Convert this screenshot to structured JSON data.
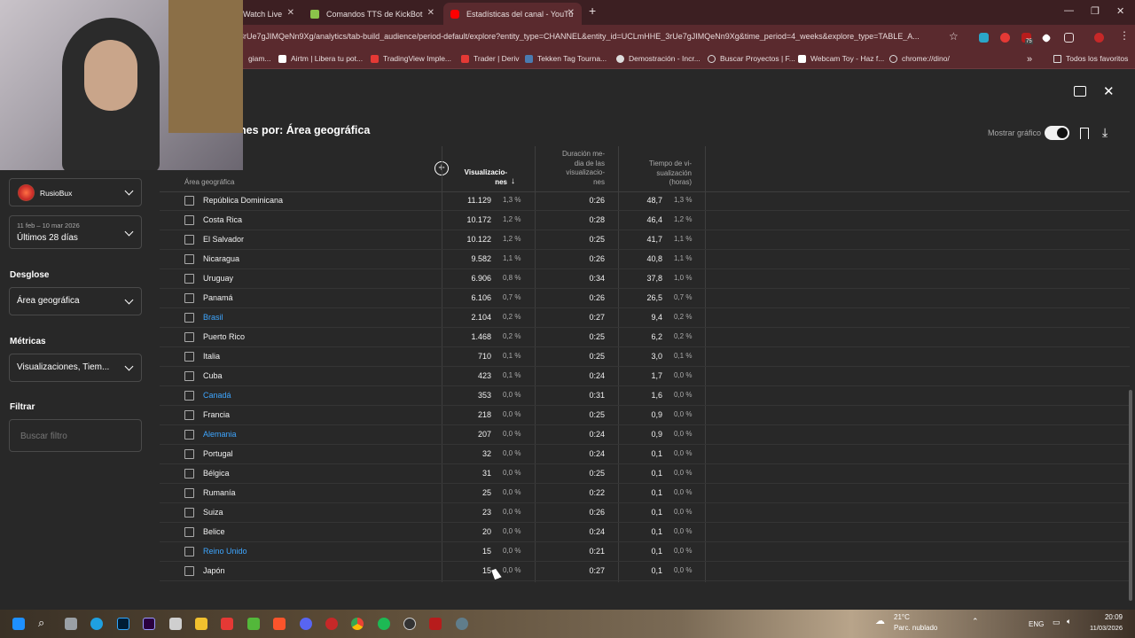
{
  "browser": {
    "tabs": [
      {
        "title": "Watch Live"
      },
      {
        "title": "Comandos TTS de KickBot"
      },
      {
        "title": "Estadísticas del canal - YouTube"
      }
    ],
    "url": "3rUe7gJIMQeNn9Xg/analytics/tab-build_audience/period-default/explore?entity_type=CHANNEL&entity_id=UCLmHHE_3rUe7gJIMQeNn9Xg&time_period=4_weeks&explore_type=TABLE_A...",
    "bookmarks": [
      "giam...",
      "Airtm | Libera tu pot...",
      "TradingView Imple...",
      "Trader | Deriv",
      "Tekken Tag Tourna...",
      "Demostración - Incr...",
      "Buscar Proyectos | F...",
      "Webcam Toy - Haz f...",
      "chrome://dino/"
    ],
    "all_bookmarks": "Todos los favoritos"
  },
  "dialog": {
    "title": "nes por: Área geográfica",
    "show_chart_label": "Mostrar gráfico"
  },
  "sidebar": {
    "channel_name": "RusioBux",
    "date_range_small": "11 feb – 10 mar 2026",
    "date_range": "Últimos 28 días",
    "breakdown_label": "Desglose",
    "breakdown_value": "Área geográfica",
    "metrics_label": "Métricas",
    "metrics_value": "Visualizaciones, Tiem...",
    "filter_label": "Filtrar",
    "filter_placeholder": "Buscar filtro"
  },
  "table": {
    "headers": {
      "geo": "Área geográfica",
      "views": "Visualizacio-\nnes",
      "avg_duration": "Duración me-\ndia de las\nvisualizacio-\nnes",
      "watch_time": "Tiempo de vi-\nsualización\n(horas)"
    },
    "rows": [
      {
        "name": "República Dominicana",
        "link": false,
        "views": "11.129",
        "views_pct": "1,3 %",
        "dur": "0:26",
        "wt": "48,7",
        "wt_pct": "1,3 %"
      },
      {
        "name": "Costa Rica",
        "link": false,
        "views": "10.172",
        "views_pct": "1,2 %",
        "dur": "0:28",
        "wt": "46,4",
        "wt_pct": "1,2 %"
      },
      {
        "name": "El Salvador",
        "link": false,
        "views": "10.122",
        "views_pct": "1,2 %",
        "dur": "0:25",
        "wt": "41,7",
        "wt_pct": "1,1 %"
      },
      {
        "name": "Nicaragua",
        "link": false,
        "views": "9.582",
        "views_pct": "1,1 %",
        "dur": "0:26",
        "wt": "40,8",
        "wt_pct": "1,1 %"
      },
      {
        "name": "Uruguay",
        "link": false,
        "views": "6.906",
        "views_pct": "0,8 %",
        "dur": "0:34",
        "wt": "37,8",
        "wt_pct": "1,0 %"
      },
      {
        "name": "Panamá",
        "link": false,
        "views": "6.106",
        "views_pct": "0,7 %",
        "dur": "0:26",
        "wt": "26,5",
        "wt_pct": "0,7 %"
      },
      {
        "name": "Brasil",
        "link": true,
        "views": "2.104",
        "views_pct": "0,2 %",
        "dur": "0:27",
        "wt": "9,4",
        "wt_pct": "0,2 %"
      },
      {
        "name": "Puerto Rico",
        "link": false,
        "views": "1.468",
        "views_pct": "0,2 %",
        "dur": "0:25",
        "wt": "6,2",
        "wt_pct": "0,2 %"
      },
      {
        "name": "Italia",
        "link": false,
        "views": "710",
        "views_pct": "0,1 %",
        "dur": "0:25",
        "wt": "3,0",
        "wt_pct": "0,1 %"
      },
      {
        "name": "Cuba",
        "link": false,
        "views": "423",
        "views_pct": "0,1 %",
        "dur": "0:24",
        "wt": "1,7",
        "wt_pct": "0,0 %"
      },
      {
        "name": "Canadá",
        "link": true,
        "views": "353",
        "views_pct": "0,0 %",
        "dur": "0:31",
        "wt": "1,6",
        "wt_pct": "0,0 %"
      },
      {
        "name": "Francia",
        "link": false,
        "views": "218",
        "views_pct": "0,0 %",
        "dur": "0:25",
        "wt": "0,9",
        "wt_pct": "0,0 %"
      },
      {
        "name": "Alemania",
        "link": true,
        "views": "207",
        "views_pct": "0,0 %",
        "dur": "0:24",
        "wt": "0,9",
        "wt_pct": "0,0 %"
      },
      {
        "name": "Portugal",
        "link": false,
        "views": "32",
        "views_pct": "0,0 %",
        "dur": "0:24",
        "wt": "0,1",
        "wt_pct": "0,0 %"
      },
      {
        "name": "Bélgica",
        "link": false,
        "views": "31",
        "views_pct": "0,0 %",
        "dur": "0:25",
        "wt": "0,1",
        "wt_pct": "0,0 %"
      },
      {
        "name": "Rumanía",
        "link": false,
        "views": "25",
        "views_pct": "0,0 %",
        "dur": "0:22",
        "wt": "0,1",
        "wt_pct": "0,0 %"
      },
      {
        "name": "Suiza",
        "link": false,
        "views": "23",
        "views_pct": "0,0 %",
        "dur": "0:26",
        "wt": "0,1",
        "wt_pct": "0,0 %"
      },
      {
        "name": "Belice",
        "link": false,
        "views": "20",
        "views_pct": "0,0 %",
        "dur": "0:24",
        "wt": "0,1",
        "wt_pct": "0,0 %"
      },
      {
        "name": "Reino Unido",
        "link": true,
        "views": "15",
        "views_pct": "0,0 %",
        "dur": "0:21",
        "wt": "0,1",
        "wt_pct": "0,0 %"
      },
      {
        "name": "Japón",
        "link": false,
        "views": "15",
        "views_pct": "0,0 %",
        "dur": "0:27",
        "wt": "0,1",
        "wt_pct": "0,0 %"
      }
    ]
  },
  "taskbar": {
    "weather_temp": "21°C",
    "weather_desc": "Parc. nublado",
    "lang": "ENG",
    "time": "20:09",
    "date": "11/03/2026",
    "badge": "75"
  }
}
